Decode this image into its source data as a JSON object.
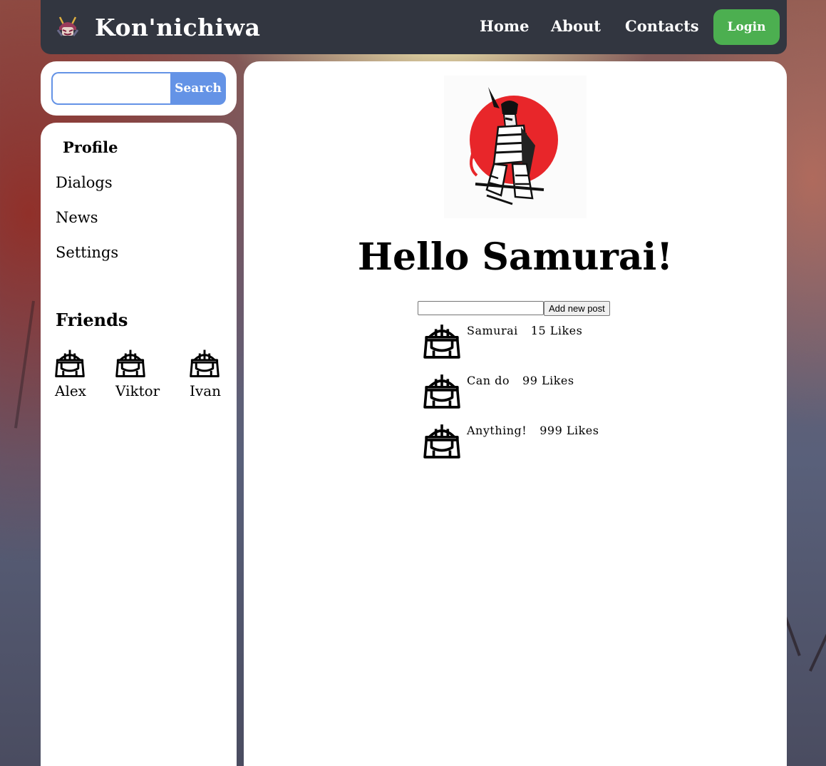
{
  "header": {
    "brand": "Kon'nichiwa",
    "nav": [
      {
        "label": "Home"
      },
      {
        "label": "About"
      },
      {
        "label": "Contacts"
      }
    ],
    "login_label": "Login"
  },
  "search": {
    "value": "",
    "button_label": "Search"
  },
  "sidebar": {
    "items": [
      {
        "label": "Profile",
        "active": true
      },
      {
        "label": "Dialogs"
      },
      {
        "label": "News"
      },
      {
        "label": "Settings"
      }
    ],
    "friends_title": "Friends",
    "friends": [
      {
        "name": "Alex"
      },
      {
        "name": "Viktor"
      },
      {
        "name": "Ivan"
      }
    ]
  },
  "main": {
    "title": "Hello Samurai!",
    "new_post": {
      "value": "",
      "button_label": "Add new post"
    },
    "posts": [
      {
        "message": "Samurai",
        "likes": "15 Likes"
      },
      {
        "message": "Can do",
        "likes": "99 Likes"
      },
      {
        "message": "Anything!",
        "likes": "999 Likes"
      }
    ]
  },
  "colors": {
    "header_bg": "#323640",
    "login_green": "#4caf50",
    "search_blue": "#6493e6",
    "sun_red": "#e8262a"
  },
  "icons": [
    "samurai-helmet-logo-icon",
    "samurai-helmet-icon"
  ]
}
